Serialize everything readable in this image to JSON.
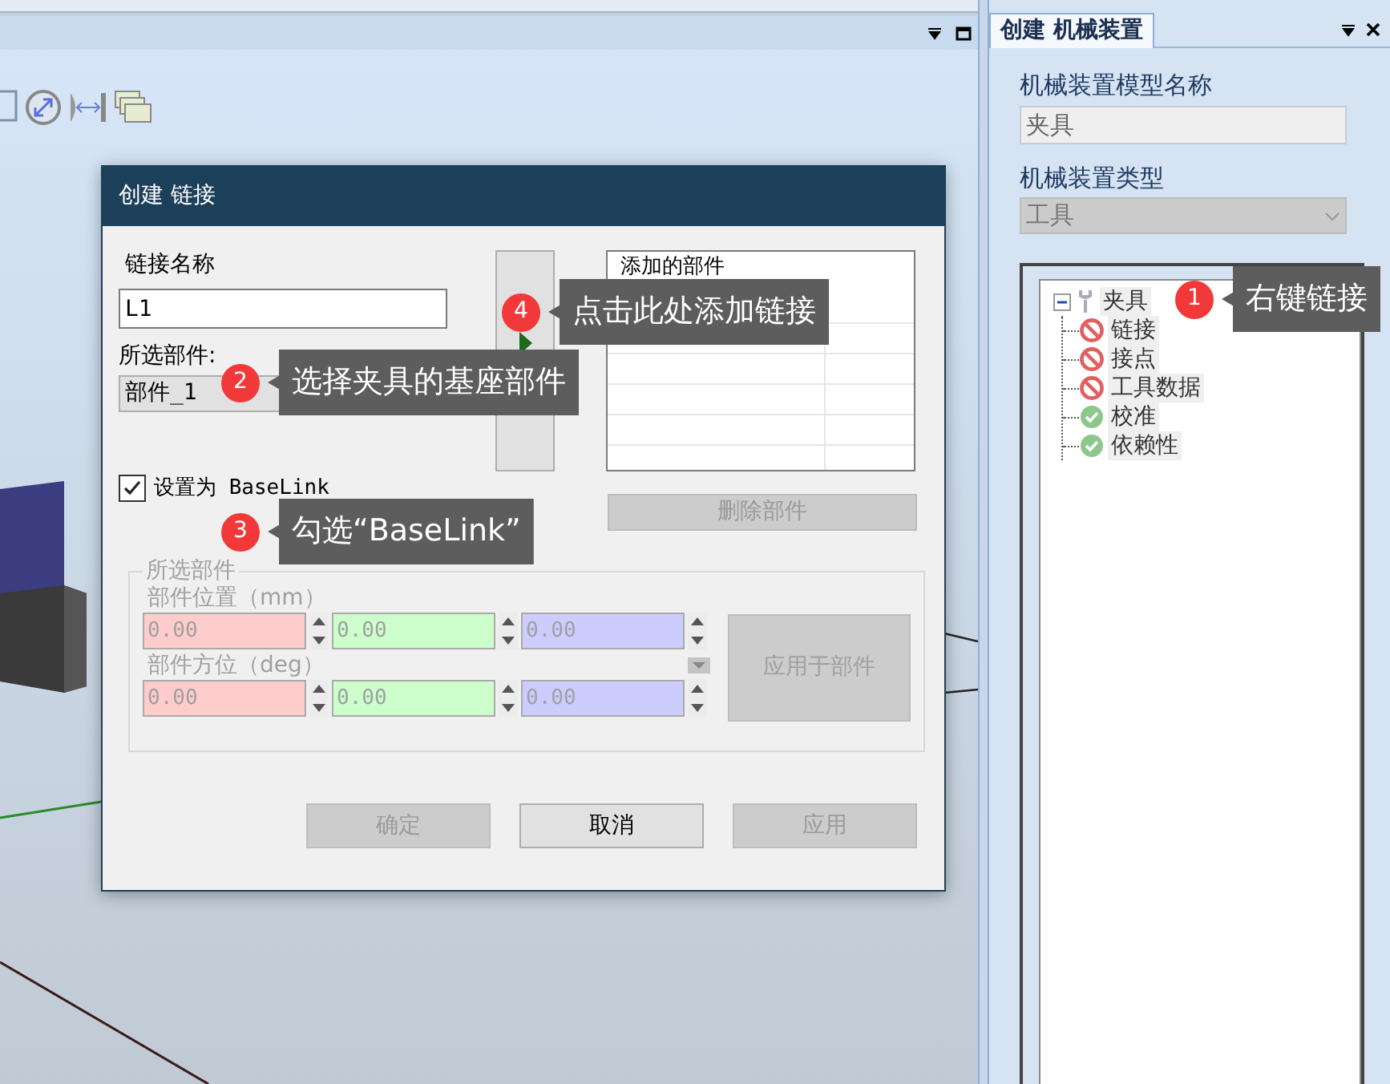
{
  "right_panel": {
    "tab": {
      "label": "创建 机械装置",
      "selected": true
    },
    "model_name_label": "机械装置模型名称",
    "model_name": "夹具",
    "type_label": "机械装置类型",
    "type_value": "工具",
    "tree": {
      "label": "夹具",
      "expanded": true,
      "children": [
        {
          "label": "链接",
          "kind": "invalid"
        },
        {
          "label": "接点",
          "kind": "invalid"
        },
        {
          "label": "工具数据",
          "kind": "invalid"
        },
        {
          "label": "校准",
          "kind": "valid"
        },
        {
          "label": "依赖性",
          "kind": "valid"
        }
      ]
    }
  },
  "dialog": {
    "title": "创建 链接",
    "link_name_label": "链接名称",
    "link_name": "L1",
    "part_label": "所选部件:",
    "part_value": "部件_1",
    "added_parts_header": "添加的部件",
    "set_baselink": {
      "label": "设置为 BaseLink",
      "checked": true
    },
    "remove_button": {
      "label": "删除部件",
      "disabled": true
    },
    "group": {
      "legend": "所选部件",
      "disabled": true,
      "apply_button": "应用于部件",
      "rows": [
        {
          "label": "部件位置（mm）",
          "values": [
            "0.00",
            "0.00",
            "0.00"
          ]
        },
        {
          "label": "部件方位（deg）",
          "values": [
            "0.00",
            "0.00",
            "0.00"
          ]
        }
      ]
    },
    "buttons": [
      {
        "label": "确定",
        "disabled": true
      },
      {
        "label": "取消",
        "disabled": false
      },
      {
        "label": "应用",
        "disabled": true
      }
    ]
  },
  "callouts": [
    {
      "number": "1",
      "text": "右键链接"
    },
    {
      "number": "2",
      "text": "选择夹具的基座部件"
    },
    {
      "number": "3",
      "text": "勾选“BaseLink”"
    },
    {
      "number": "4",
      "text": "点击此处添加链接"
    }
  ]
}
